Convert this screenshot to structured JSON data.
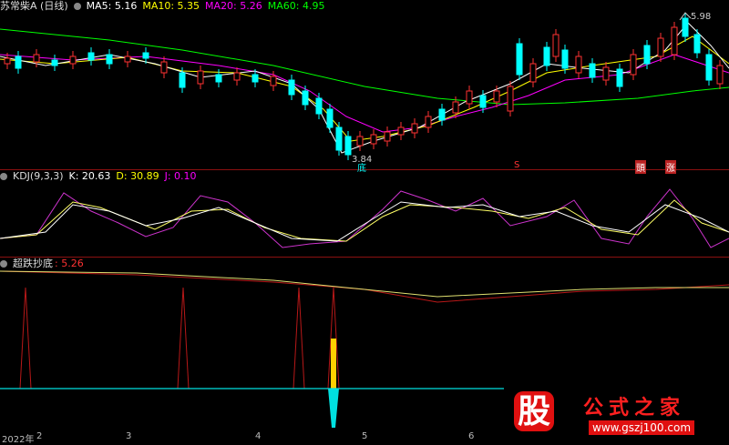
{
  "price_panel": {
    "title": "苏常柴A (日线)",
    "ma5": "MA5: 5.16",
    "ma10": "MA10: 5.35",
    "ma20": "MA20: 5.26",
    "ma60": "MA60: 4.95",
    "high_label": "5.98",
    "low_label": "3.84",
    "signal_low": "底",
    "signal_s": "S",
    "signal_a": "頭",
    "signal_b": "涨"
  },
  "kdj_panel": {
    "name": "KDJ(9,3,3)",
    "k": "K: 20.63",
    "d": "D: 30.89",
    "j": "J: 0.10"
  },
  "ind_panel": {
    "name": "超跌抄底",
    "value": ": 5.26"
  },
  "x_axis": {
    "labels": [
      "2022年",
      "2",
      "3",
      "4",
      "5",
      "6"
    ]
  },
  "logo": {
    "mark": "股",
    "title": "公式之家",
    "url": "www.gszj100.com"
  },
  "colors": {
    "ma5": "#ffffff",
    "ma10": "#ffff00",
    "ma20": "#ff00ff",
    "ma60": "#00ff00",
    "up": "#ff3232",
    "down": "#00ffff",
    "separator": "#8b1010"
  }
}
